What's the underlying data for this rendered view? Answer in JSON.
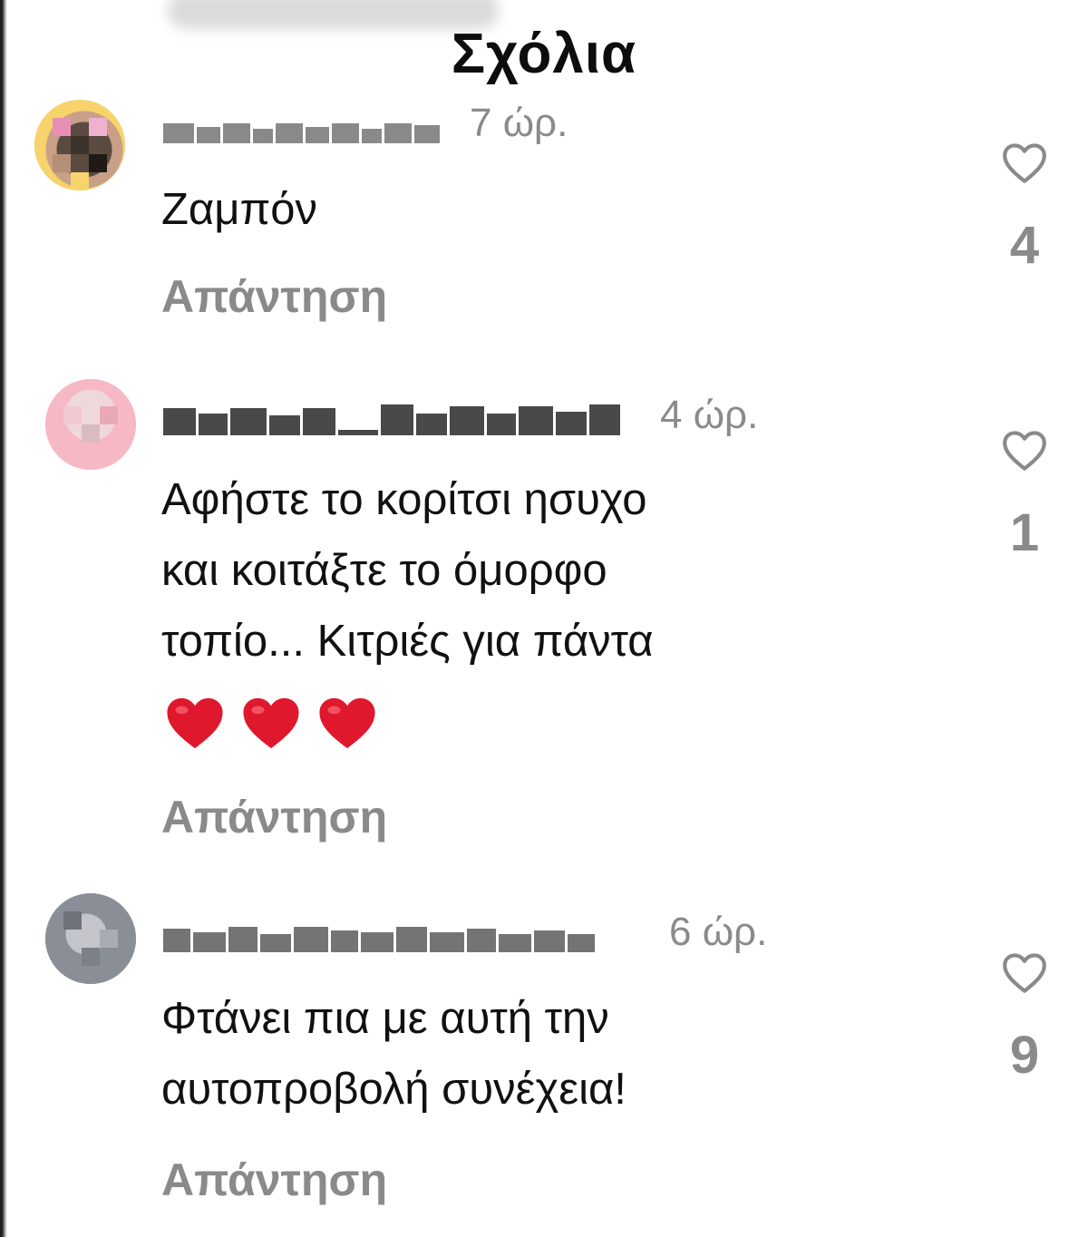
{
  "sheet": {
    "title": "Σχόλια"
  },
  "comments": [
    {
      "time": "7 ώρ.",
      "text": "Ζαμπόν",
      "reply_label": "Απάντηση",
      "likes": "4",
      "avatar_colors": [
        "#f2a7c9",
        "#6b5a4e",
        "#f7d36b"
      ]
    },
    {
      "time": "4 ώρ.",
      "text": "Αφήστε το κορίτσι ησυχο\nκαι κοιτάξτε το όμορφο\nτοπίο... Κιτριές για πάντα",
      "emoji": [
        "❤️",
        "❤️",
        "❤️"
      ],
      "reply_label": "Απάντηση",
      "likes": "1",
      "avatar_colors": [
        "#f6b8c4",
        "#eed8dc"
      ]
    },
    {
      "time": "6 ώρ.",
      "text": "Φτάνει πια με αυτή την\nαυτοπροβολή συνέχεια!",
      "reply_label": "Απάντηση",
      "likes": "9",
      "avatar_colors": [
        "#8a8e97",
        "#c4c6cb"
      ]
    }
  ],
  "icons": {
    "like": "heart-outline-icon",
    "emoji": "red-heart-emoji"
  },
  "colors": {
    "muted": "#8a8a8a",
    "text": "#111111",
    "heart": "#e0182d"
  }
}
